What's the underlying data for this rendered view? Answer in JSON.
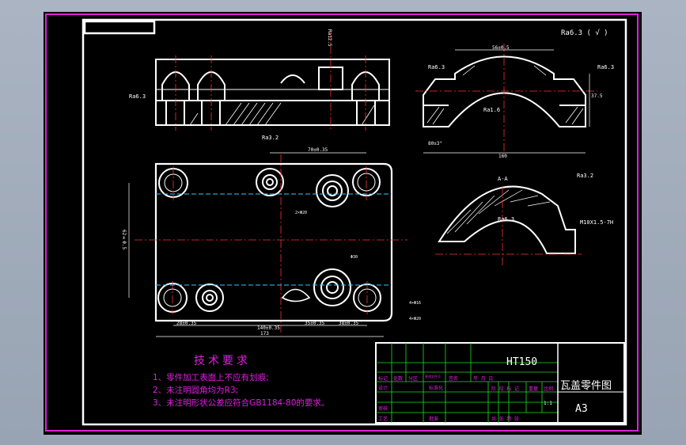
{
  "colors": {
    "background": "#000000",
    "border": "#ffffff",
    "frame": "#e01ee0",
    "grid": "#22dd22",
    "center": "#ff3030",
    "hidden": "#30c8ff",
    "dim": "#ffffff"
  },
  "notes": {
    "title": "技术要求",
    "items": [
      "1、零件加工表面上不应有划痕;",
      "2、未注明圆角均为R3;",
      "3、未注明形状公差应符合GB1184-80的要求。"
    ]
  },
  "title_block": {
    "material": "HT150",
    "part_name": "瓦盖零件图",
    "sheet_size": "A3",
    "scale": "1:1",
    "revision_headers": [
      "标记",
      "处数",
      "分区",
      "更改文件号",
      "签名",
      "年 月 日"
    ],
    "left_labels": [
      "设计",
      "审核",
      "工艺"
    ],
    "mid_labels": [
      "标准化",
      "批准"
    ],
    "stage_headers": [
      "阶 段 标 记",
      "重量",
      "比例"
    ],
    "sheet_count": "共  张  第  张"
  },
  "annotations": {
    "surface_default": "Ra6.3 ( √ )",
    "ra63": "Ra6.3",
    "ra32": "Ra3.2",
    "ra16": "Ra1.6",
    "ra125": "Ra12.5",
    "section": "A-A",
    "thread": "M10X1.5-7H",
    "dim_top_width": "56±0.5",
    "dim_height": "37.5",
    "dim_base_width": "160",
    "dim_angle": "80±3°",
    "dim_center": "70±0.35",
    "dim_total": "173",
    "dim_bottom_a": "28±0.35",
    "dim_bottom_b": "140±0.35",
    "dim_bottom_c": "35±0.35",
    "dim_bottom_d": "38±0.35",
    "dim_side": "62±0.5",
    "hole_a": "4×Φ16",
    "hole_b": "4×Φ20",
    "hole_c": "2×Φ20",
    "hole_d": "Φ30"
  }
}
